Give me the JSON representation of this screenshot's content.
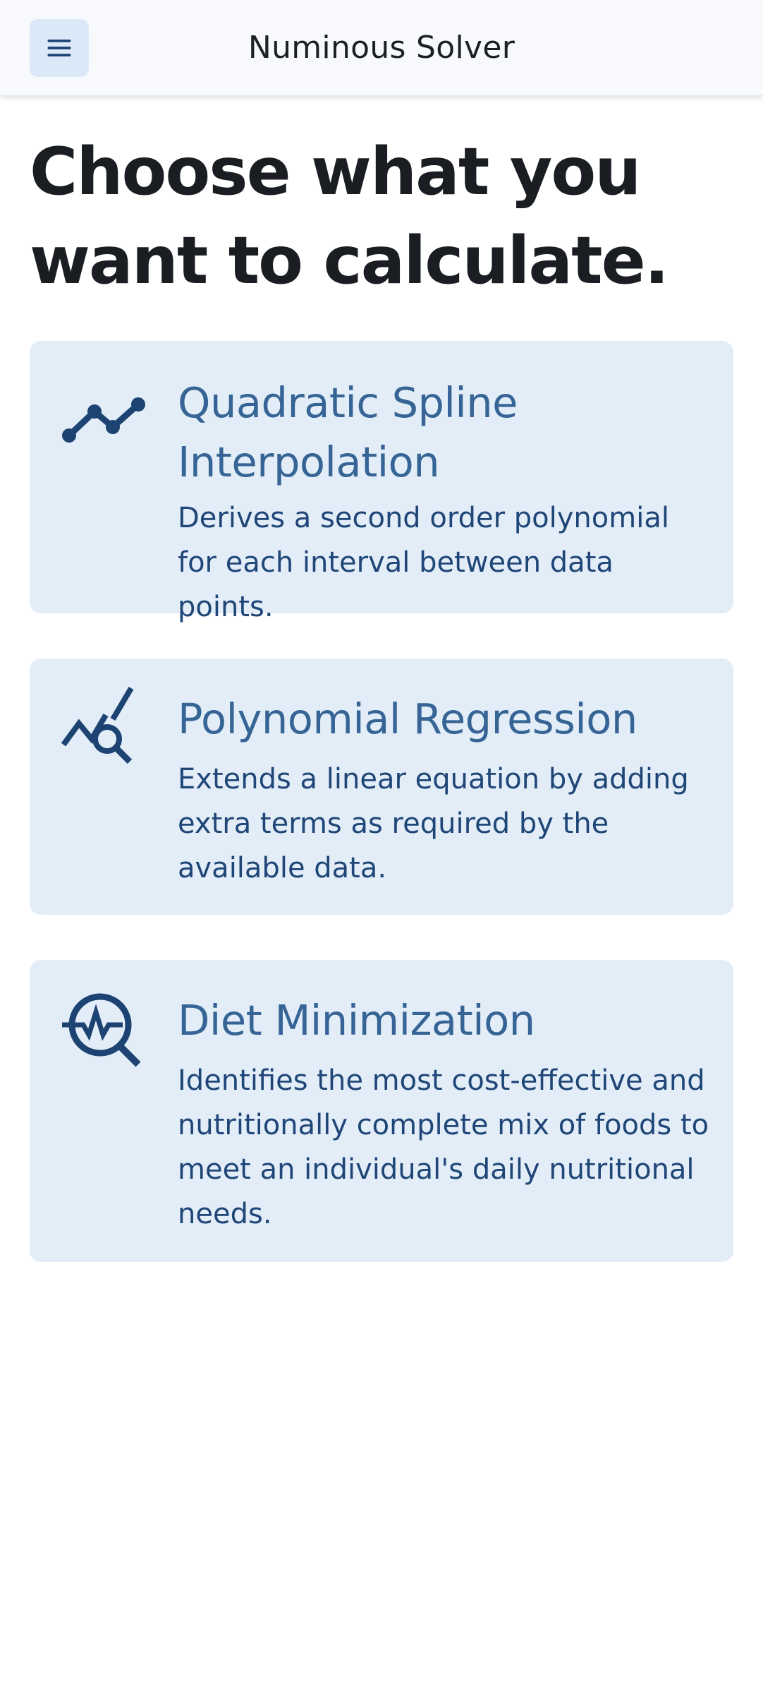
{
  "header": {
    "app_title": "Numinous Solver",
    "menu_icon": "menu-icon"
  },
  "page": {
    "heading": "Choose what you want to calculate."
  },
  "colors": {
    "card_background": "#e2edf8",
    "card_title": "#356495",
    "card_text": "#1f4677",
    "icon": "#1c4372",
    "menu_button_background": "#dbe8f7"
  },
  "cards": [
    {
      "title": "Quadratic Spline Interpolation",
      "description": "Derives a second order polynomial for each interval between data points.",
      "icon": "line-chart-icon"
    },
    {
      "title": "Polynomial Regression",
      "description": "Extends a linear equation by adding extra terms as required by the available data.",
      "icon": "chart-search-icon"
    },
    {
      "title": "Diet Minimization",
      "description": "Identifies the most cost-effective and nutritionally complete mix of foods to meet an individual's daily nutritional needs.",
      "icon": "pulse-search-icon"
    }
  ]
}
